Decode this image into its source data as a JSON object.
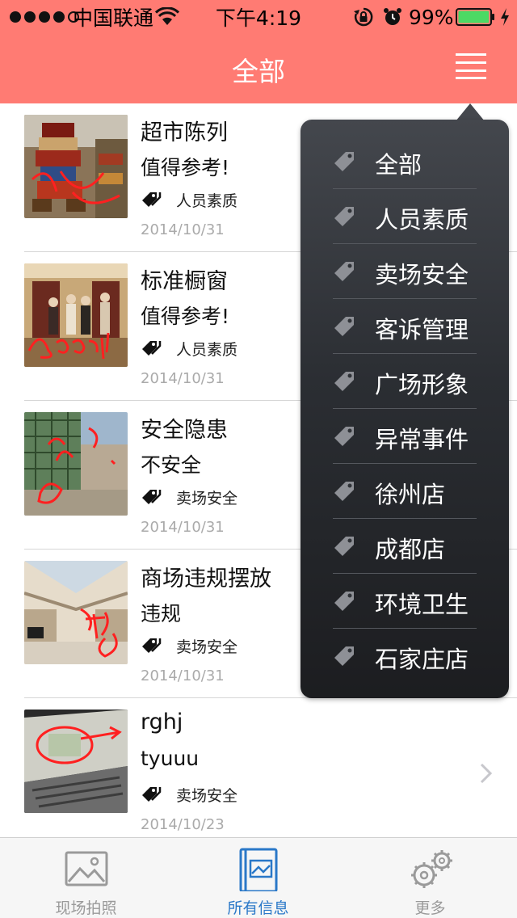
{
  "status_bar": {
    "carrier": "中国联通",
    "time": "下午4:19",
    "battery_percent": "99%",
    "battery_level": 0.99,
    "signal_bars": 4,
    "signal_bars_total": 5
  },
  "header": {
    "title": "全部",
    "background": "#ff7b73",
    "menu_icon": "menu-icon"
  },
  "list": [
    {
      "title": "超市陈列",
      "subtitle": "值得参考!",
      "tag": "人员素质",
      "date": "2014/10/31",
      "thumb": "supermarket-photo"
    },
    {
      "title": "标准橱窗",
      "subtitle": "值得参考!",
      "tag": "人员素质",
      "date": "2014/10/31",
      "thumb": "window-display-photo"
    },
    {
      "title": "安全隐患",
      "subtitle": "不安全",
      "tag": "卖场安全",
      "date": "2014/10/31",
      "thumb": "construction-photo"
    },
    {
      "title": "商场违规摆放",
      "subtitle": "违规",
      "tag": "卖场安全",
      "date": "2014/10/31",
      "thumb": "mall-interior-photo"
    },
    {
      "title": "rghj",
      "subtitle": "tyuuu",
      "tag": "卖场安全",
      "date": "2014/10/23",
      "thumb": "laptop-photo"
    }
  ],
  "dropdown": {
    "items": [
      "全部",
      "人员素质",
      "卖场安全",
      "客诉管理",
      "广场形象",
      "异常事件",
      "徐州店",
      "成都店",
      "环境卫生",
      "石家庄店"
    ],
    "icon": "tag-icon"
  },
  "tabbar": {
    "tabs": [
      {
        "label": "现场拍照",
        "icon": "photo-icon",
        "active": false
      },
      {
        "label": "所有信息",
        "icon": "book-icon",
        "active": true
      },
      {
        "label": "更多",
        "icon": "gears-icon",
        "active": false
      }
    ],
    "active_color": "#2a78c8",
    "inactive_color": "#9a9a9a"
  }
}
